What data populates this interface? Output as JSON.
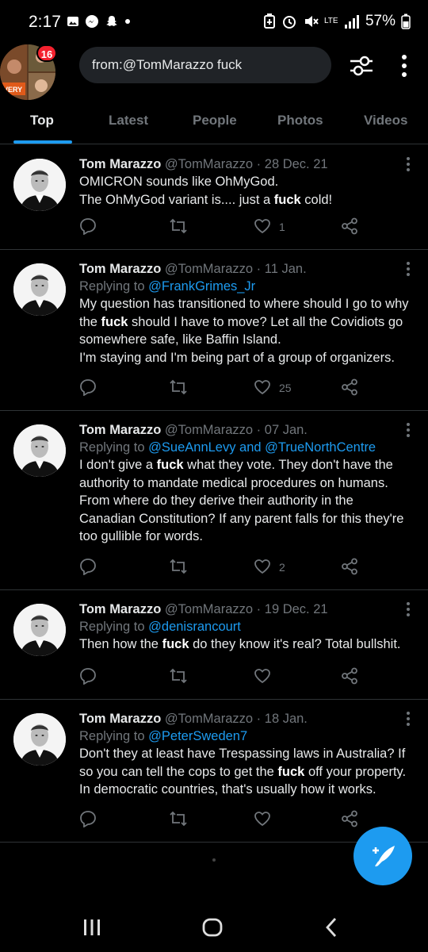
{
  "status_bar": {
    "time": "2:17",
    "network": "LTE",
    "battery": "57%"
  },
  "header": {
    "notification_count": "16",
    "search_query": "from:@TomMarazzo fuck",
    "avatar_caption": "VERY"
  },
  "tabs": [
    {
      "label": "Top",
      "active": true
    },
    {
      "label": "Latest",
      "active": false
    },
    {
      "label": "People",
      "active": false
    },
    {
      "label": "Photos",
      "active": false
    },
    {
      "label": "Videos",
      "active": false
    }
  ],
  "tweets": [
    {
      "name": "Tom Marazzo",
      "handle": "@TomMarazzo",
      "date": "28 Dec. 21",
      "reply_prefix": "",
      "reply_to": "",
      "lines": [
        {
          "before": "OMICRON sounds like OhMyGod.",
          "bold": "",
          "after": ""
        },
        {
          "before": "The OhMyGod variant is.... just a ",
          "bold": "fuck",
          "after": " cold!"
        }
      ],
      "likes": "1"
    },
    {
      "name": "Tom Marazzo",
      "handle": "@TomMarazzo",
      "date": "11 Jan.",
      "reply_prefix": "Replying to",
      "reply_to": "@FrankGrimes_Jr",
      "lines": [
        {
          "before": "My question has transitioned to where should I go to why",
          "bold": "",
          "after": ""
        },
        {
          "before": "the ",
          "bold": "fuck",
          "after": " should I have to move?  Let all the Covidiots go"
        },
        {
          "before": "somewhere safe, like Baffin Island.",
          "bold": "",
          "after": ""
        },
        {
          "before": "I'm staying and I'm being part of a group of organizers.",
          "bold": "",
          "after": ""
        }
      ],
      "likes": "25"
    },
    {
      "name": "Tom Marazzo",
      "handle": "@TomMarazzo",
      "date": "07 Jan.",
      "reply_prefix": "Replying to",
      "reply_to": "@SueAnnLevy and @TrueNorthCentre",
      "lines": [
        {
          "before": "I don't give a ",
          "bold": "fuck",
          "after": " what they vote. They don't have the"
        },
        {
          "before": "authority to mandate medical procedures on humans.",
          "bold": "",
          "after": ""
        },
        {
          "before": "From where do they derive their authority in the",
          "bold": "",
          "after": ""
        },
        {
          "before": "Canadian Constitution?  If any parent falls for this they're",
          "bold": "",
          "after": ""
        },
        {
          "before": "too gullible for words.",
          "bold": "",
          "after": ""
        }
      ],
      "likes": "2"
    },
    {
      "name": "Tom Marazzo",
      "handle": "@TomMarazzo",
      "date": "19 Dec. 21",
      "reply_prefix": "Replying to",
      "reply_to": "@denisrancourt",
      "lines": [
        {
          "before": "Then how the ",
          "bold": "fuck",
          "after": " do they know it's real?  Total bullshit."
        }
      ],
      "likes": ""
    },
    {
      "name": "Tom Marazzo",
      "handle": "@TomMarazzo",
      "date": "18 Jan.",
      "reply_prefix": "Replying to",
      "reply_to": "@PeterSweden7",
      "lines": [
        {
          "before": "Don't they at least have Trespassing laws in Australia?  If",
          "bold": "",
          "after": ""
        },
        {
          "before": "so you can tell the cops to get the ",
          "bold": "fuck",
          "after": " off your property."
        },
        {
          "before": "In democratic countries,  that's usually how it works.",
          "bold": "",
          "after": ""
        }
      ],
      "likes": ""
    }
  ],
  "colors": {
    "accent": "#1d9bf0",
    "muted": "#71767b",
    "badge": "#f4212e",
    "background": "#000000"
  },
  "icons": [
    "reply-icon",
    "retweet-icon",
    "like-icon",
    "share-icon",
    "compose-icon",
    "filter-icon",
    "more-icon"
  ]
}
